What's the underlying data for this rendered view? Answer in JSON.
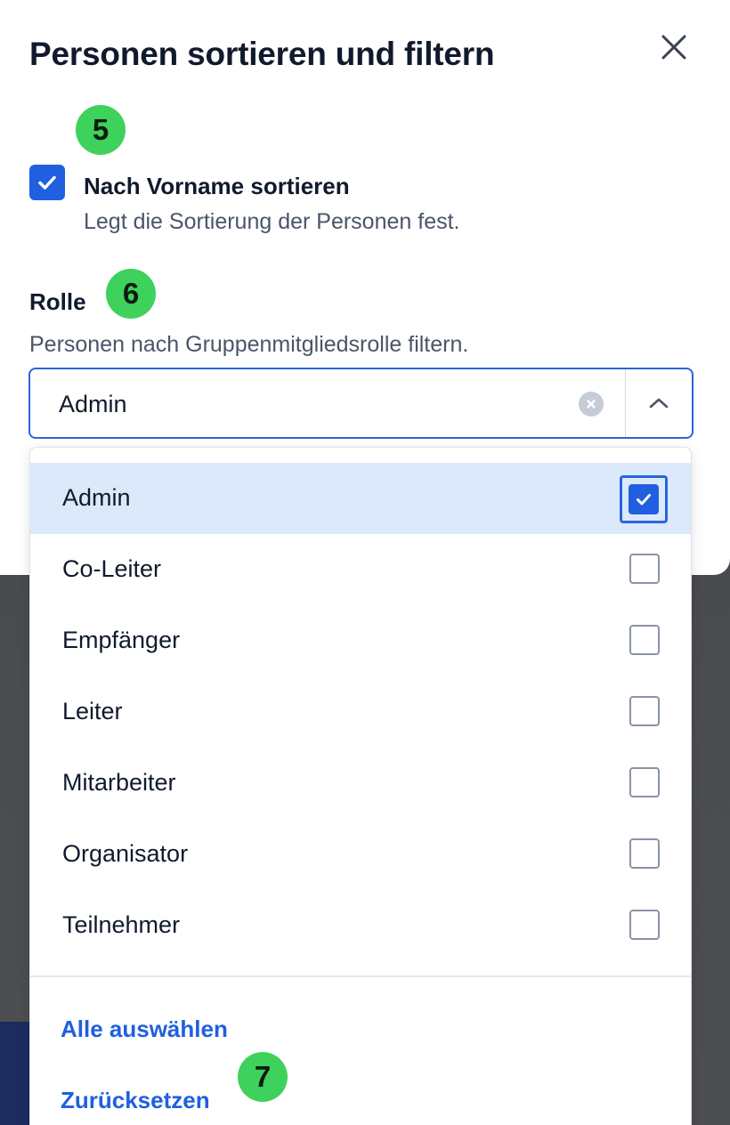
{
  "modal": {
    "title": "Personen sortieren und filtern"
  },
  "badges": {
    "step5": "5",
    "step6": "6",
    "step7": "7"
  },
  "sort": {
    "label": "Nach Vorname sortieren",
    "help": "Legt die Sortierung der Personen fest.",
    "checked": true
  },
  "role": {
    "label": "Rolle",
    "help": "Personen nach Gruppenmitgliedsrolle filtern.",
    "selected_value": "Admin"
  },
  "dropdown": {
    "options": [
      {
        "label": "Admin",
        "checked": true
      },
      {
        "label": "Co-Leiter",
        "checked": false
      },
      {
        "label": "Empfänger",
        "checked": false
      },
      {
        "label": "Leiter",
        "checked": false
      },
      {
        "label": "Mitarbeiter",
        "checked": false
      },
      {
        "label": "Organisator",
        "checked": false
      },
      {
        "label": "Teilnehmer",
        "checked": false
      }
    ],
    "select_all": "Alle auswählen",
    "reset": "Zurücksetzen"
  },
  "colors": {
    "accent": "#1f5fe0",
    "badge": "#3ed15b",
    "selected_row": "#dce9fb"
  }
}
